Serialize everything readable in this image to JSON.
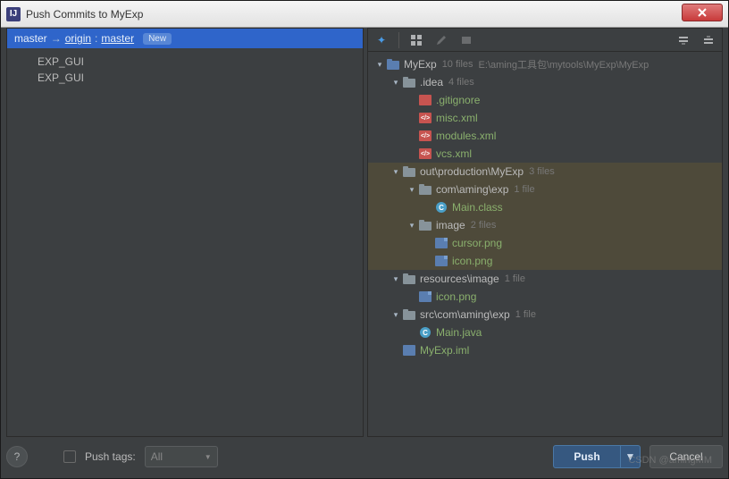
{
  "window": {
    "title": "Push Commits to MyExp"
  },
  "left": {
    "branch": {
      "local": "master",
      "arrow": "→",
      "remote": "origin",
      "sep": ":",
      "remote_branch": "master",
      "badge": "New"
    },
    "commits": [
      "EXP_GUI",
      "EXP_GUI"
    ]
  },
  "tree": {
    "root": {
      "name": "MyExp",
      "count": "10 files",
      "path": "E:\\aming工具包\\mytools\\MyExp\\MyExp"
    },
    "idea": {
      "name": ".idea",
      "count": "4 files",
      "files": [
        ".gitignore",
        "misc.xml",
        "modules.xml",
        "vcs.xml"
      ]
    },
    "out": {
      "name": "out\\production\\MyExp",
      "count": "3 files",
      "pkg": {
        "name": "com\\aming\\exp",
        "count": "1 file",
        "file": "Main.class"
      },
      "image": {
        "name": "image",
        "count": "2 files",
        "files": [
          "cursor.png",
          "icon.png"
        ]
      }
    },
    "resources": {
      "name": "resources\\image",
      "count": "1 file",
      "file": "icon.png"
    },
    "src": {
      "name": "src\\com\\aming\\exp",
      "count": "1 file",
      "file": "Main.java"
    },
    "iml": "MyExp.iml"
  },
  "bottom": {
    "push_tags_label": "Push tags:",
    "select_value": "All",
    "push": "Push",
    "cancel": "Cancel"
  },
  "watermark": "CSDN @amingMM"
}
